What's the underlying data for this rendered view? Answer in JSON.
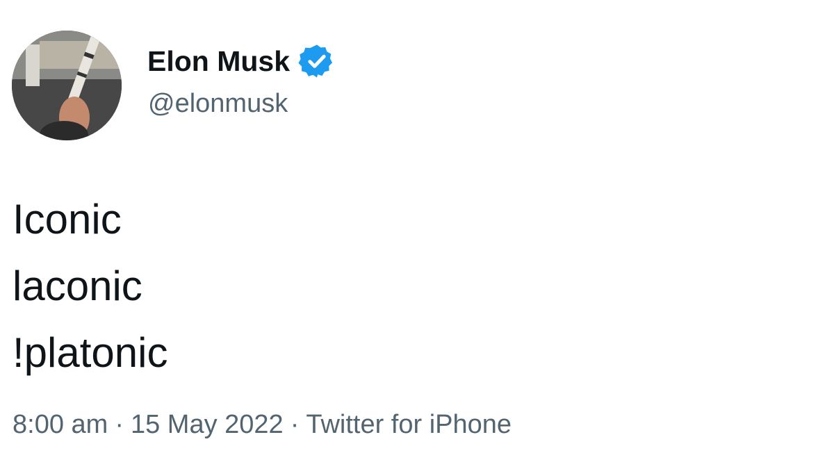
{
  "tweet": {
    "author": {
      "display_name": "Elon Musk",
      "handle": "@elonmusk",
      "verified_icon": "verified-badge-icon"
    },
    "body_lines": [
      "Iconic",
      "laconic",
      "!platonic"
    ],
    "meta": {
      "time": "8:00 am",
      "date": "15 May 2022",
      "source": "Twitter for iPhone",
      "separator": "·"
    }
  },
  "colors": {
    "primary_text": "#0f1419",
    "secondary_text": "#536471",
    "verified_blue": "#1d9bf0",
    "background": "#ffffff"
  }
}
